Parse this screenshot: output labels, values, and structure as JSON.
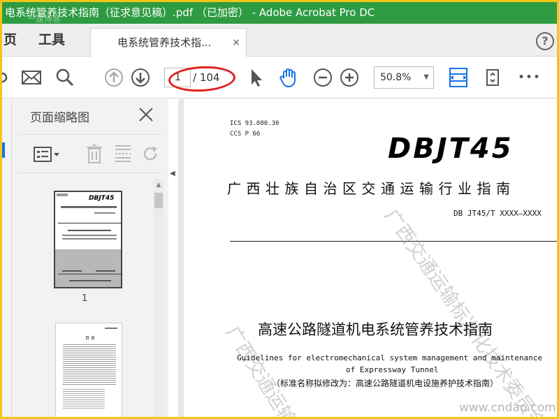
{
  "window": {
    "title": "电系统管养技术指南（征求意见稿）.pdf （已加密） - Adobe Acrobat Pro DC",
    "title_watermark": "一建博客"
  },
  "tabs": {
    "nav": [
      "页",
      "工具"
    ],
    "document": "电系统管养技术指...",
    "close": "×",
    "help": "?"
  },
  "toolbar": {
    "current_page": "1",
    "total_pages": "/ 104",
    "zoom": "50.8%",
    "more": "•••"
  },
  "thumbnails": {
    "title": "页面缩略图",
    "page1_label": "1",
    "page1_heading": "DBJT45",
    "page2_heading": "目 录"
  },
  "document": {
    "ics": "ICS  93.080.30",
    "ccs": "CCS  P 66",
    "standard_logo": "DBJT45",
    "guide_title": "广西壮族自治区交通运输行业指南",
    "code": "DB JT45/T XXXX—XXXX",
    "main_title": "高速公路隧道机电系统管养技术指南",
    "en_title_1": "Guidelines for electromechanical system management and maintenance",
    "en_title_2": "of Expressway Tunnel",
    "cn_note": "（标准名称拟修改为：高速公路隧道机电设施养护技术指南）",
    "watermark_1": "广西交通运输标准化技术委员会",
    "watermark_2": "广西交通运输",
    "watermark_url": "www.cndao.com"
  },
  "colors": {
    "title_bar": "#2e9b43",
    "frame": "#f3c613",
    "accent_blue": "#1473e6",
    "annotation_red": "#e0201c"
  }
}
